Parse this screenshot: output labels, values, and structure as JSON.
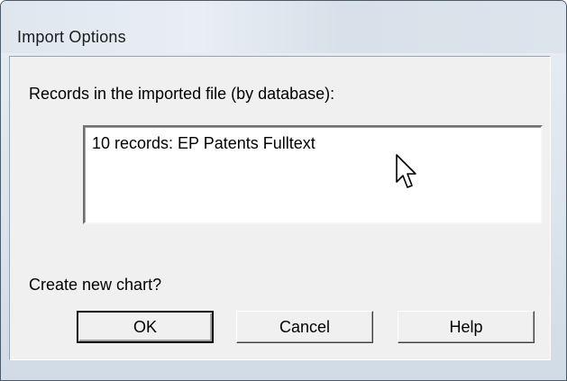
{
  "window": {
    "title": "Import Options"
  },
  "records": {
    "label": "Records in the imported file (by database):",
    "items": [
      "10 records: EP Patents Fulltext"
    ]
  },
  "chart": {
    "question": "Create new chart?"
  },
  "buttons": {
    "ok": "OK",
    "cancel": "Cancel",
    "help": "Help"
  },
  "icons": {
    "cursor": "mouse-pointer-icon"
  },
  "colors": {
    "dialog_face": "#f0f0f0",
    "title_glass": "#dbe3ec",
    "list_background": "#ffffff"
  }
}
